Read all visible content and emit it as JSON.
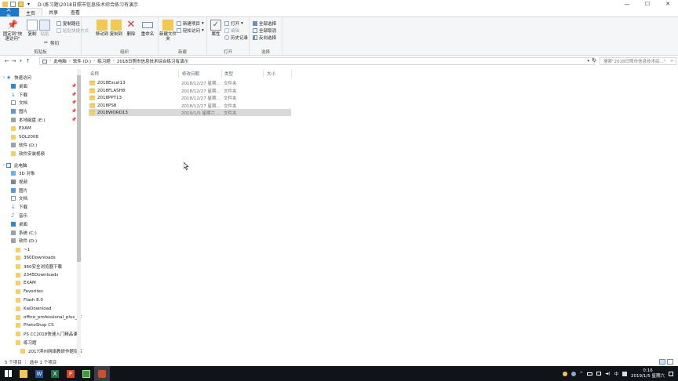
{
  "window": {
    "title": "D:\\练习题\\2018日照市信息技术综合练习有演示"
  },
  "ribbon_tabs": [
    {
      "label": "文件"
    },
    {
      "label": "主页"
    },
    {
      "label": "共享"
    },
    {
      "label": "查看"
    }
  ],
  "ribbon": {
    "clipboard": {
      "pin_label": "固定到\"快速访问\"",
      "copy_label": "复制",
      "paste_label": "粘贴",
      "copy_path": "复制路径",
      "paste_shortcut": "粘贴快捷方式",
      "cut": "剪切",
      "group": "剪贴板"
    },
    "organize": {
      "move_to": "移动到",
      "copy_to": "复制到",
      "delete": "删除",
      "rename": "重命名",
      "group": "组织"
    },
    "new": {
      "new_folder": "新建文件夹",
      "new_item": "新建项目",
      "easy_access": "轻松访问",
      "group": "新建"
    },
    "open": {
      "properties": "属性",
      "open": "打开",
      "edit": "编辑",
      "history": "历史记录",
      "group": "打开"
    },
    "select": {
      "select_all": "全部选择",
      "select_none": "全部取消",
      "invert": "反向选择",
      "group": "选择"
    }
  },
  "address": {
    "crumbs": [
      "此电脑",
      "软件 (D:)",
      "练习题",
      "2018日照市信息技术综合练习有演示"
    ],
    "search_placeholder": "搜索\"2018日照市信息技术综...\""
  },
  "nav": {
    "quick_access": "快速访问",
    "quick_items": [
      "桌面",
      "下载",
      "文档",
      "图片",
      "本地磁盘 (E:)",
      "EXAM",
      "SQL2008",
      "软件 (D:)",
      "软件安装视频"
    ],
    "this_pc": "此电脑",
    "pc_items": [
      "3D 对象",
      "视频",
      "图片",
      "文档",
      "下载",
      "音乐",
      "桌面",
      "系统 (C:)",
      "软件 (D:)"
    ],
    "d_items": [
      "~1",
      "360Downloads",
      "360安全浏览器下载",
      "2345Downloads",
      "EXAM",
      "Favorites",
      "Flash 8.0",
      "KwDownload",
      "office_professional_plus_20",
      "PhotoShop CS",
      "PS CC2018快速入门精品课",
      "练习题",
      "2017滨州网络教研作题有版"
    ]
  },
  "columns": {
    "name": "名称",
    "date": "修改日期",
    "type": "类型",
    "size": "大小"
  },
  "files": [
    {
      "name": "2018Excel13",
      "date": "2018/12/27 星期...",
      "type": "文件夹"
    },
    {
      "name": "2018FLASH8",
      "date": "2018/12/27 星期...",
      "type": "文件夹"
    },
    {
      "name": "2018PPT13",
      "date": "2018/12/27 星期...",
      "type": "文件夹"
    },
    {
      "name": "2018PS8",
      "date": "2018/12/27 星期...",
      "type": "文件夹"
    },
    {
      "name": "2018WORD13",
      "date": "2019/1/5 星期六 ...",
      "type": "文件夹"
    }
  ],
  "status": {
    "count": "5 个项目",
    "selected": "选中 1 个项目"
  },
  "taskbar": {
    "time": "0:16",
    "date": "2019/1/5 星期六"
  },
  "colors": {
    "file_tab": "#1979ca",
    "folder": "#f7cf63",
    "taskbar": "#101418",
    "selected_row": "#d9d9d9"
  }
}
